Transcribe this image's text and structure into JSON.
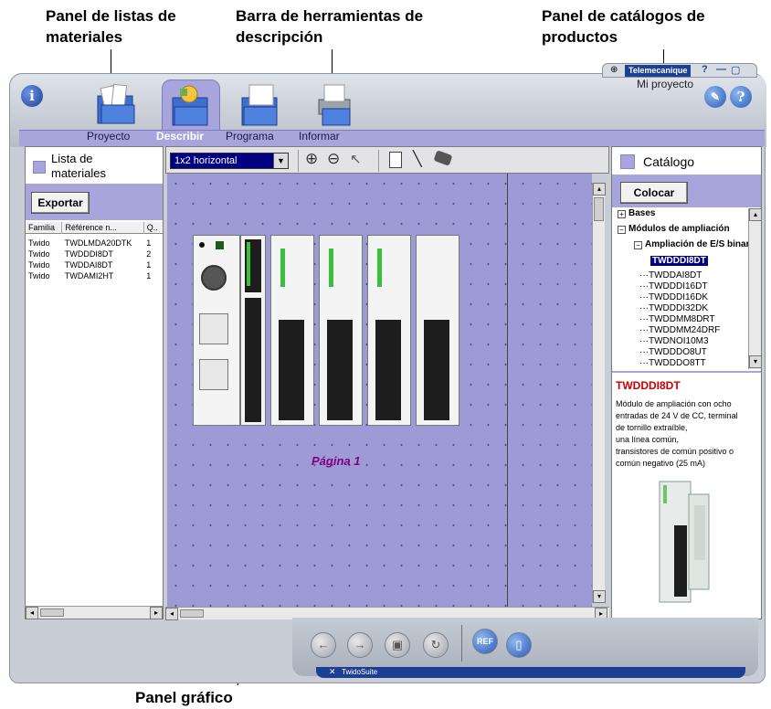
{
  "annotations": {
    "bom_panel_line1": "Panel de listas de",
    "bom_panel_line2": "materiales",
    "toolbar_line1": "Barra de herramientas de",
    "toolbar_line2": "descripción",
    "catalog_line1": "Panel de catálogos de",
    "catalog_line2": "productos",
    "graphic_panel": "Panel gráfico"
  },
  "brand": {
    "name": "Telemecanique",
    "project": "Mi proyecto",
    "suite": "TwidoSuite"
  },
  "tabs": [
    {
      "label": "Proyecto"
    },
    {
      "label": "Describir"
    },
    {
      "label": "Programa"
    },
    {
      "label": "Informar"
    }
  ],
  "bom": {
    "title_line1": "Lista de",
    "title_line2": "materiales",
    "export_label": "Exportar",
    "columns": [
      "Familia",
      "Référence n...",
      "Q.."
    ],
    "rows": [
      [
        "Twido",
        "TWDLMDA20DTK",
        "1"
      ],
      [
        "Twido",
        "TWDDDI8DT",
        "2"
      ],
      [
        "Twido",
        "TWDDAI8DT",
        "1"
      ],
      [
        "Twido",
        "TWDAMI2HT",
        "1"
      ]
    ]
  },
  "toolbar": {
    "layout_select": "1x2 horizontal",
    "tools": [
      "zoom-in-icon",
      "zoom-out-icon",
      "pointer-icon",
      "module-icon",
      "cable-icon",
      "eraser-icon"
    ]
  },
  "canvas": {
    "page_label": "Página 1"
  },
  "catalog": {
    "title": "Catálogo",
    "place_label": "Colocar",
    "tree": {
      "bases": "Bases",
      "expansion": "Módulos de ampliación",
      "io_expansion": "Ampliación de E/S binari",
      "items": [
        "TWDDDI8DT",
        "TWDDAI8DT",
        "TWDDDI16DT",
        "TWDDDI16DK",
        "TWDDDI32DK",
        "TWDDMM8DRT",
        "TWDDMM24DRF",
        "TWDNOI10M3",
        "TWDDDO8UT",
        "TWDDDO8TT"
      ]
    },
    "selected_name": "TWDDDI8DT",
    "description": [
      "Módulo de ampliación con ocho",
      "entradas de 24 V de CC, terminal",
      "de tornillo extraíble,",
      "una línea común,",
      "transistores de común positivo o",
      "común negativo (25 mA)"
    ]
  },
  "colors": {
    "accent": "#a7a5db",
    "canvas": "#9d9ad6",
    "selection": "#000080",
    "product_name": "#cc0000",
    "page_label": "#800080"
  }
}
